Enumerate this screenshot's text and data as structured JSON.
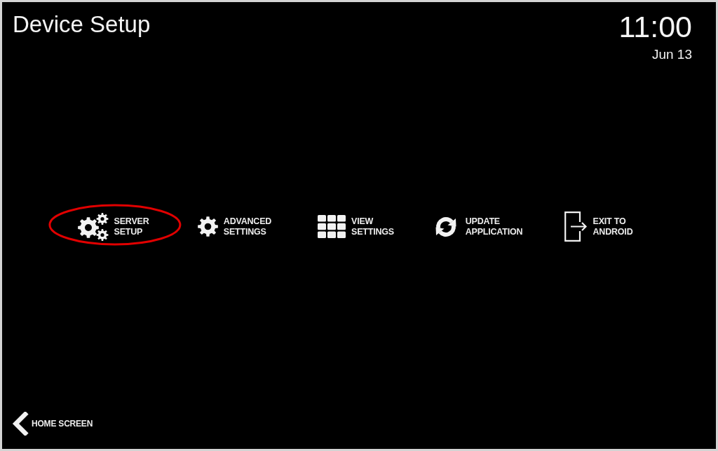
{
  "title": "Device Setup",
  "clock": {
    "time": "11:00",
    "date": "Jun 13"
  },
  "menu": [
    {
      "kind": "gears",
      "lines": [
        "SERVER",
        "SETUP"
      ],
      "highlighted": true
    },
    {
      "kind": "gear",
      "lines": [
        "ADVANCED",
        "SETTINGS"
      ],
      "highlighted": false
    },
    {
      "kind": "grid",
      "lines": [
        "VIEW",
        "SETTINGS"
      ],
      "highlighted": false
    },
    {
      "kind": "refresh",
      "lines": [
        "UPDATE",
        "APPLICATION"
      ],
      "highlighted": false
    },
    {
      "kind": "exit",
      "lines": [
        "EXIT TO",
        "ANDROID"
      ],
      "highlighted": false
    }
  ],
  "back_button": {
    "label": "HOME SCREEN"
  }
}
